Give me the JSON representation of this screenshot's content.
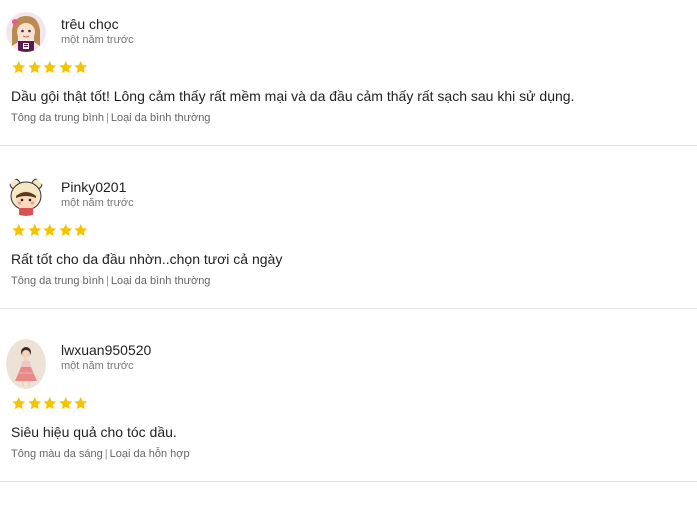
{
  "reviews": [
    {
      "username": "trêu chọc",
      "time": "một năm trước",
      "rating": 5,
      "text": "Dầu gội thật tốt! Lông cảm thấy rất mềm mại và da đầu cảm thấy rất sạch sau khi sử dụng.",
      "skin_tone": "Tông da trung bình",
      "skin_type": "Loại da bình thường",
      "avatar_icon": "cartoon-girl-avatar"
    },
    {
      "username": "Pinky0201",
      "time": "một năm trước",
      "rating": 5,
      "text": "Rất tốt cho da đầu nhờn..chọn tươi cả ngày",
      "skin_tone": "Tông da trung bình",
      "skin_type": "Loại da bình thường",
      "avatar_icon": "cartoon-bear-hood-avatar"
    },
    {
      "username": "lwxuan950520",
      "time": "một năm trước",
      "rating": 5,
      "text": "Siêu hiệu quả cho tóc dầu.",
      "skin_tone": "Tông màu da sáng",
      "skin_type": "Loại da hỗn hợp",
      "avatar_icon": "child-photo-avatar"
    }
  ],
  "colors": {
    "star": "#f5c400",
    "divider": "#e3e3e3",
    "muted_text": "#777777"
  }
}
